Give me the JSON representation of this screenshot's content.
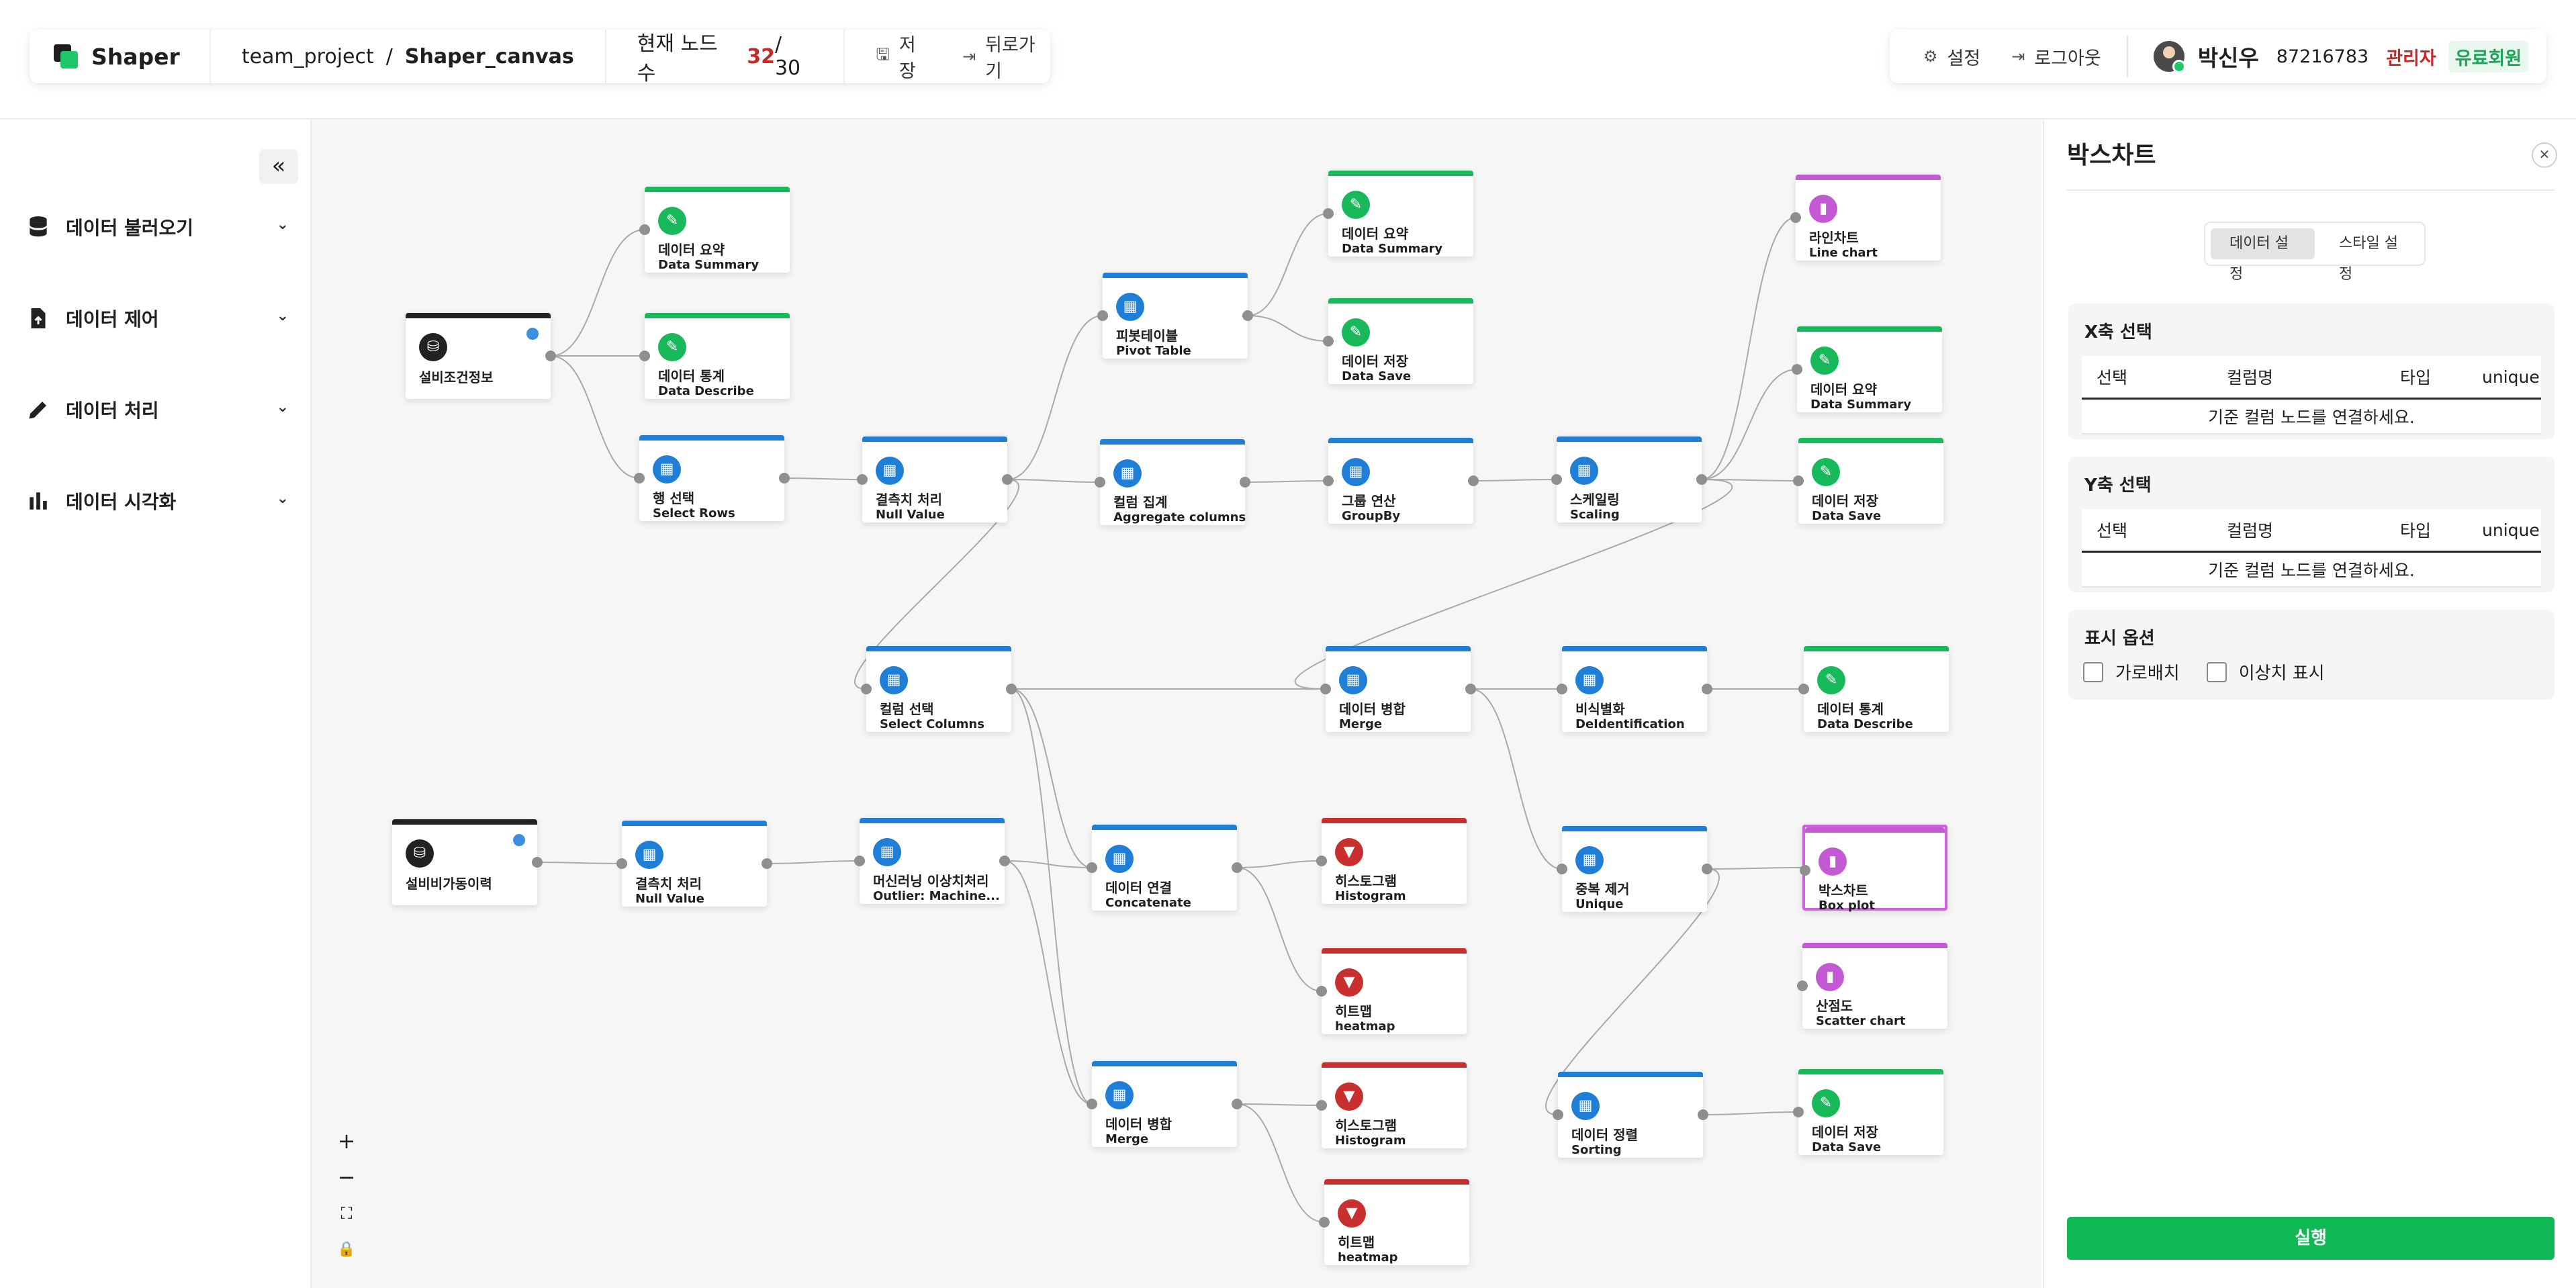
{
  "app": {
    "name": "Shaper"
  },
  "breadcrumb": {
    "project": "team_project",
    "separator": "/",
    "canvas": "Shaper_canvas"
  },
  "node_count": {
    "label": "현재 노드 수",
    "current": "32",
    "max": "/ 30"
  },
  "toolbar": {
    "save": "저장",
    "back": "뒤로가기"
  },
  "account": {
    "settings": "설정",
    "logout": "로그아웃",
    "name": "박신우",
    "id": "87216783",
    "role": "관리자",
    "plan": "유료회원"
  },
  "sidebar": {
    "items": [
      {
        "label": "데이터 불러오기",
        "icon": "database-icon"
      },
      {
        "label": "데이터 제어",
        "icon": "file-upload-icon"
      },
      {
        "label": "데이터 처리",
        "icon": "pencil-icon"
      },
      {
        "label": "데이터 시각화",
        "icon": "bar-chart-icon"
      }
    ]
  },
  "colors": {
    "blue": "#1f7fd6",
    "green": "#18b95a",
    "red": "#c8302f",
    "purple": "#c45ad3",
    "dark": "#222222",
    "accent": "#11b856"
  },
  "nodes": {
    "n1": {
      "l1": "설비조건정보",
      "l2": ""
    },
    "n2": {
      "l1": "데이터 요약",
      "l2": "Data Summary"
    },
    "n3": {
      "l1": "데이터 통계",
      "l2": "Data Describe"
    },
    "n4": {
      "l1": "행 선택",
      "l2": "Select Rows"
    },
    "n5": {
      "l1": "결측치 처리",
      "l2": "Null Value"
    },
    "n6": {
      "l1": "피봇테이블",
      "l2": "Pivot Table"
    },
    "n7": {
      "l1": "컬럼 집계",
      "l2": "Aggregate columns"
    },
    "n8": {
      "l1": "데이터 요약",
      "l2": "Data Summary"
    },
    "n9": {
      "l1": "데이터 저장",
      "l2": "Data Save"
    },
    "n10": {
      "l1": "그룹 연산",
      "l2": "GroupBy"
    },
    "n11": {
      "l1": "스케일링",
      "l2": "Scaling"
    },
    "n12": {
      "l1": "라인차트",
      "l2": "Line chart"
    },
    "n13": {
      "l1": "데이터 요약",
      "l2": "Data Summary"
    },
    "n14": {
      "l1": "데이터 저장",
      "l2": "Data Save"
    },
    "n15": {
      "l1": "컬럼 선택",
      "l2": "Select Columns"
    },
    "n16": {
      "l1": "데이터 병합",
      "l2": "Merge"
    },
    "n17": {
      "l1": "비식별화",
      "l2": "DeIdentification"
    },
    "n18": {
      "l1": "데이터 통계",
      "l2": "Data Describe"
    },
    "n19": {
      "l1": "설비비가동이력",
      "l2": ""
    },
    "n20": {
      "l1": "결측치 처리",
      "l2": "Null Value"
    },
    "n21": {
      "l1": "머신러닝 이상치처리",
      "l2": "Outlier: Machine..."
    },
    "n22": {
      "l1": "데이터 연결",
      "l2": "Concatenate"
    },
    "n23": {
      "l1": "히스토그램",
      "l2": "Histogram"
    },
    "n24": {
      "l1": "히트맵",
      "l2": "heatmap"
    },
    "n25": {
      "l1": "중복 제거",
      "l2": "Unique"
    },
    "n26": {
      "l1": "박스차트",
      "l2": "Box plot"
    },
    "n27": {
      "l1": "산점도",
      "l2": "Scatter chart"
    },
    "n28": {
      "l1": "데이터 병합",
      "l2": "Merge"
    },
    "n29": {
      "l1": "히스토그램",
      "l2": "Histogram"
    },
    "n30": {
      "l1": "히트맵",
      "l2": "heatmap"
    },
    "n31": {
      "l1": "데이터 정렬",
      "l2": "Sorting"
    },
    "n32": {
      "l1": "데이터 저장",
      "l2": "Data Save"
    }
  },
  "zoom": {
    "in": "+",
    "out": "−",
    "fit": "⛶",
    "lock": "🔒"
  },
  "panel": {
    "title": "박스차트",
    "tabs": [
      "데이터 설정",
      "스타일 설정"
    ],
    "x_section": {
      "title": "X축 선택",
      "cols": [
        "선택",
        "컬럼명",
        "타입",
        "unique"
      ],
      "empty": "기준 컬럼 노드를 연결하세요."
    },
    "y_section": {
      "title": "Y축 선택",
      "cols": [
        "선택",
        "컬럼명",
        "타입",
        "unique"
      ],
      "empty": "기준 컬럼 노드를 연결하세요."
    },
    "options": {
      "title": "표시 옵션",
      "horizontal": "가로배치",
      "outlier": "이상치 표시"
    },
    "run": "실행"
  }
}
